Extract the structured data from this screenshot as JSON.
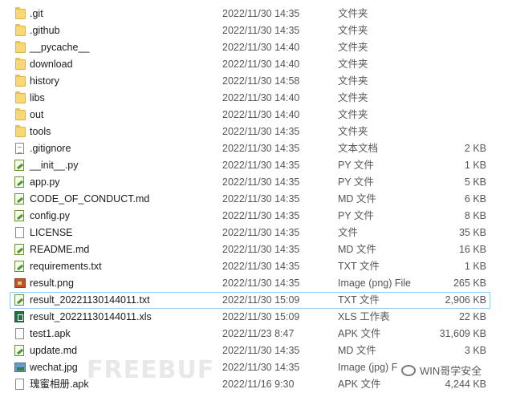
{
  "files": [
    {
      "name": ".git",
      "date": "2022/11/30 14:35",
      "type": "文件夹",
      "size": "",
      "icon": "folder-icon"
    },
    {
      "name": ".github",
      "date": "2022/11/30 14:35",
      "type": "文件夹",
      "size": "",
      "icon": "folder-icon"
    },
    {
      "name": "__pycache__",
      "date": "2022/11/30 14:40",
      "type": "文件夹",
      "size": "",
      "icon": "folder-icon"
    },
    {
      "name": "download",
      "date": "2022/11/30 14:40",
      "type": "文件夹",
      "size": "",
      "icon": "folder-icon"
    },
    {
      "name": "history",
      "date": "2022/11/30 14:58",
      "type": "文件夹",
      "size": "",
      "icon": "folder-icon"
    },
    {
      "name": "libs",
      "date": "2022/11/30 14:40",
      "type": "文件夹",
      "size": "",
      "icon": "folder-icon"
    },
    {
      "name": "out",
      "date": "2022/11/30 14:40",
      "type": "文件夹",
      "size": "",
      "icon": "folder-icon"
    },
    {
      "name": "tools",
      "date": "2022/11/30 14:35",
      "type": "文件夹",
      "size": "",
      "icon": "folder-icon"
    },
    {
      "name": ".gitignore",
      "date": "2022/11/30 14:35",
      "type": "文本文档",
      "size": "2 KB",
      "icon": "text-file-icon"
    },
    {
      "name": "__init__.py",
      "date": "2022/11/30 14:35",
      "type": "PY 文件",
      "size": "1 KB",
      "icon": "python-file-icon"
    },
    {
      "name": "app.py",
      "date": "2022/11/30 14:35",
      "type": "PY 文件",
      "size": "5 KB",
      "icon": "python-file-icon"
    },
    {
      "name": "CODE_OF_CONDUCT.md",
      "date": "2022/11/30 14:35",
      "type": "MD 文件",
      "size": "6 KB",
      "icon": "markdown-file-icon"
    },
    {
      "name": "config.py",
      "date": "2022/11/30 14:35",
      "type": "PY 文件",
      "size": "8 KB",
      "icon": "python-file-icon"
    },
    {
      "name": "LICENSE",
      "date": "2022/11/30 14:35",
      "type": "文件",
      "size": "35 KB",
      "icon": "blank-file-icon"
    },
    {
      "name": "README.md",
      "date": "2022/11/30 14:35",
      "type": "MD 文件",
      "size": "16 KB",
      "icon": "markdown-file-icon"
    },
    {
      "name": "requirements.txt",
      "date": "2022/11/30 14:35",
      "type": "TXT 文件",
      "size": "1 KB",
      "icon": "markdown-file-icon"
    },
    {
      "name": "result.png",
      "date": "2022/11/30 14:35",
      "type": "Image (png) File",
      "size": "265 KB",
      "icon": "image-file-icon"
    },
    {
      "name": "result_20221130144011.txt",
      "date": "2022/11/30 15:09",
      "type": "TXT 文件",
      "size": "2,906 KB",
      "icon": "markdown-file-icon",
      "selected": true
    },
    {
      "name": "result_20221130144011.xls",
      "date": "2022/11/30 15:09",
      "type": "XLS 工作表",
      "size": "22 KB",
      "icon": "excel-file-icon"
    },
    {
      "name": "test1.apk",
      "date": "2022/11/23 8:47",
      "type": "APK 文件",
      "size": "31,609 KB",
      "icon": "blank-file-icon"
    },
    {
      "name": "update.md",
      "date": "2022/11/30 14:35",
      "type": "MD 文件",
      "size": "3 KB",
      "icon": "markdown-file-icon"
    },
    {
      "name": "wechat.jpg",
      "date": "2022/11/30 14:35",
      "type": "Image (jpg) F",
      "size": "",
      "icon": "jpg-file-icon"
    },
    {
      "name": "瑰蜜相册.apk",
      "date": "2022/11/16 9:30",
      "type": "APK 文件",
      "size": "4,244 KB",
      "icon": "blank-file-icon"
    }
  ],
  "watermark": {
    "left": "FREEBUF",
    "right": "WIN哥学安全"
  }
}
